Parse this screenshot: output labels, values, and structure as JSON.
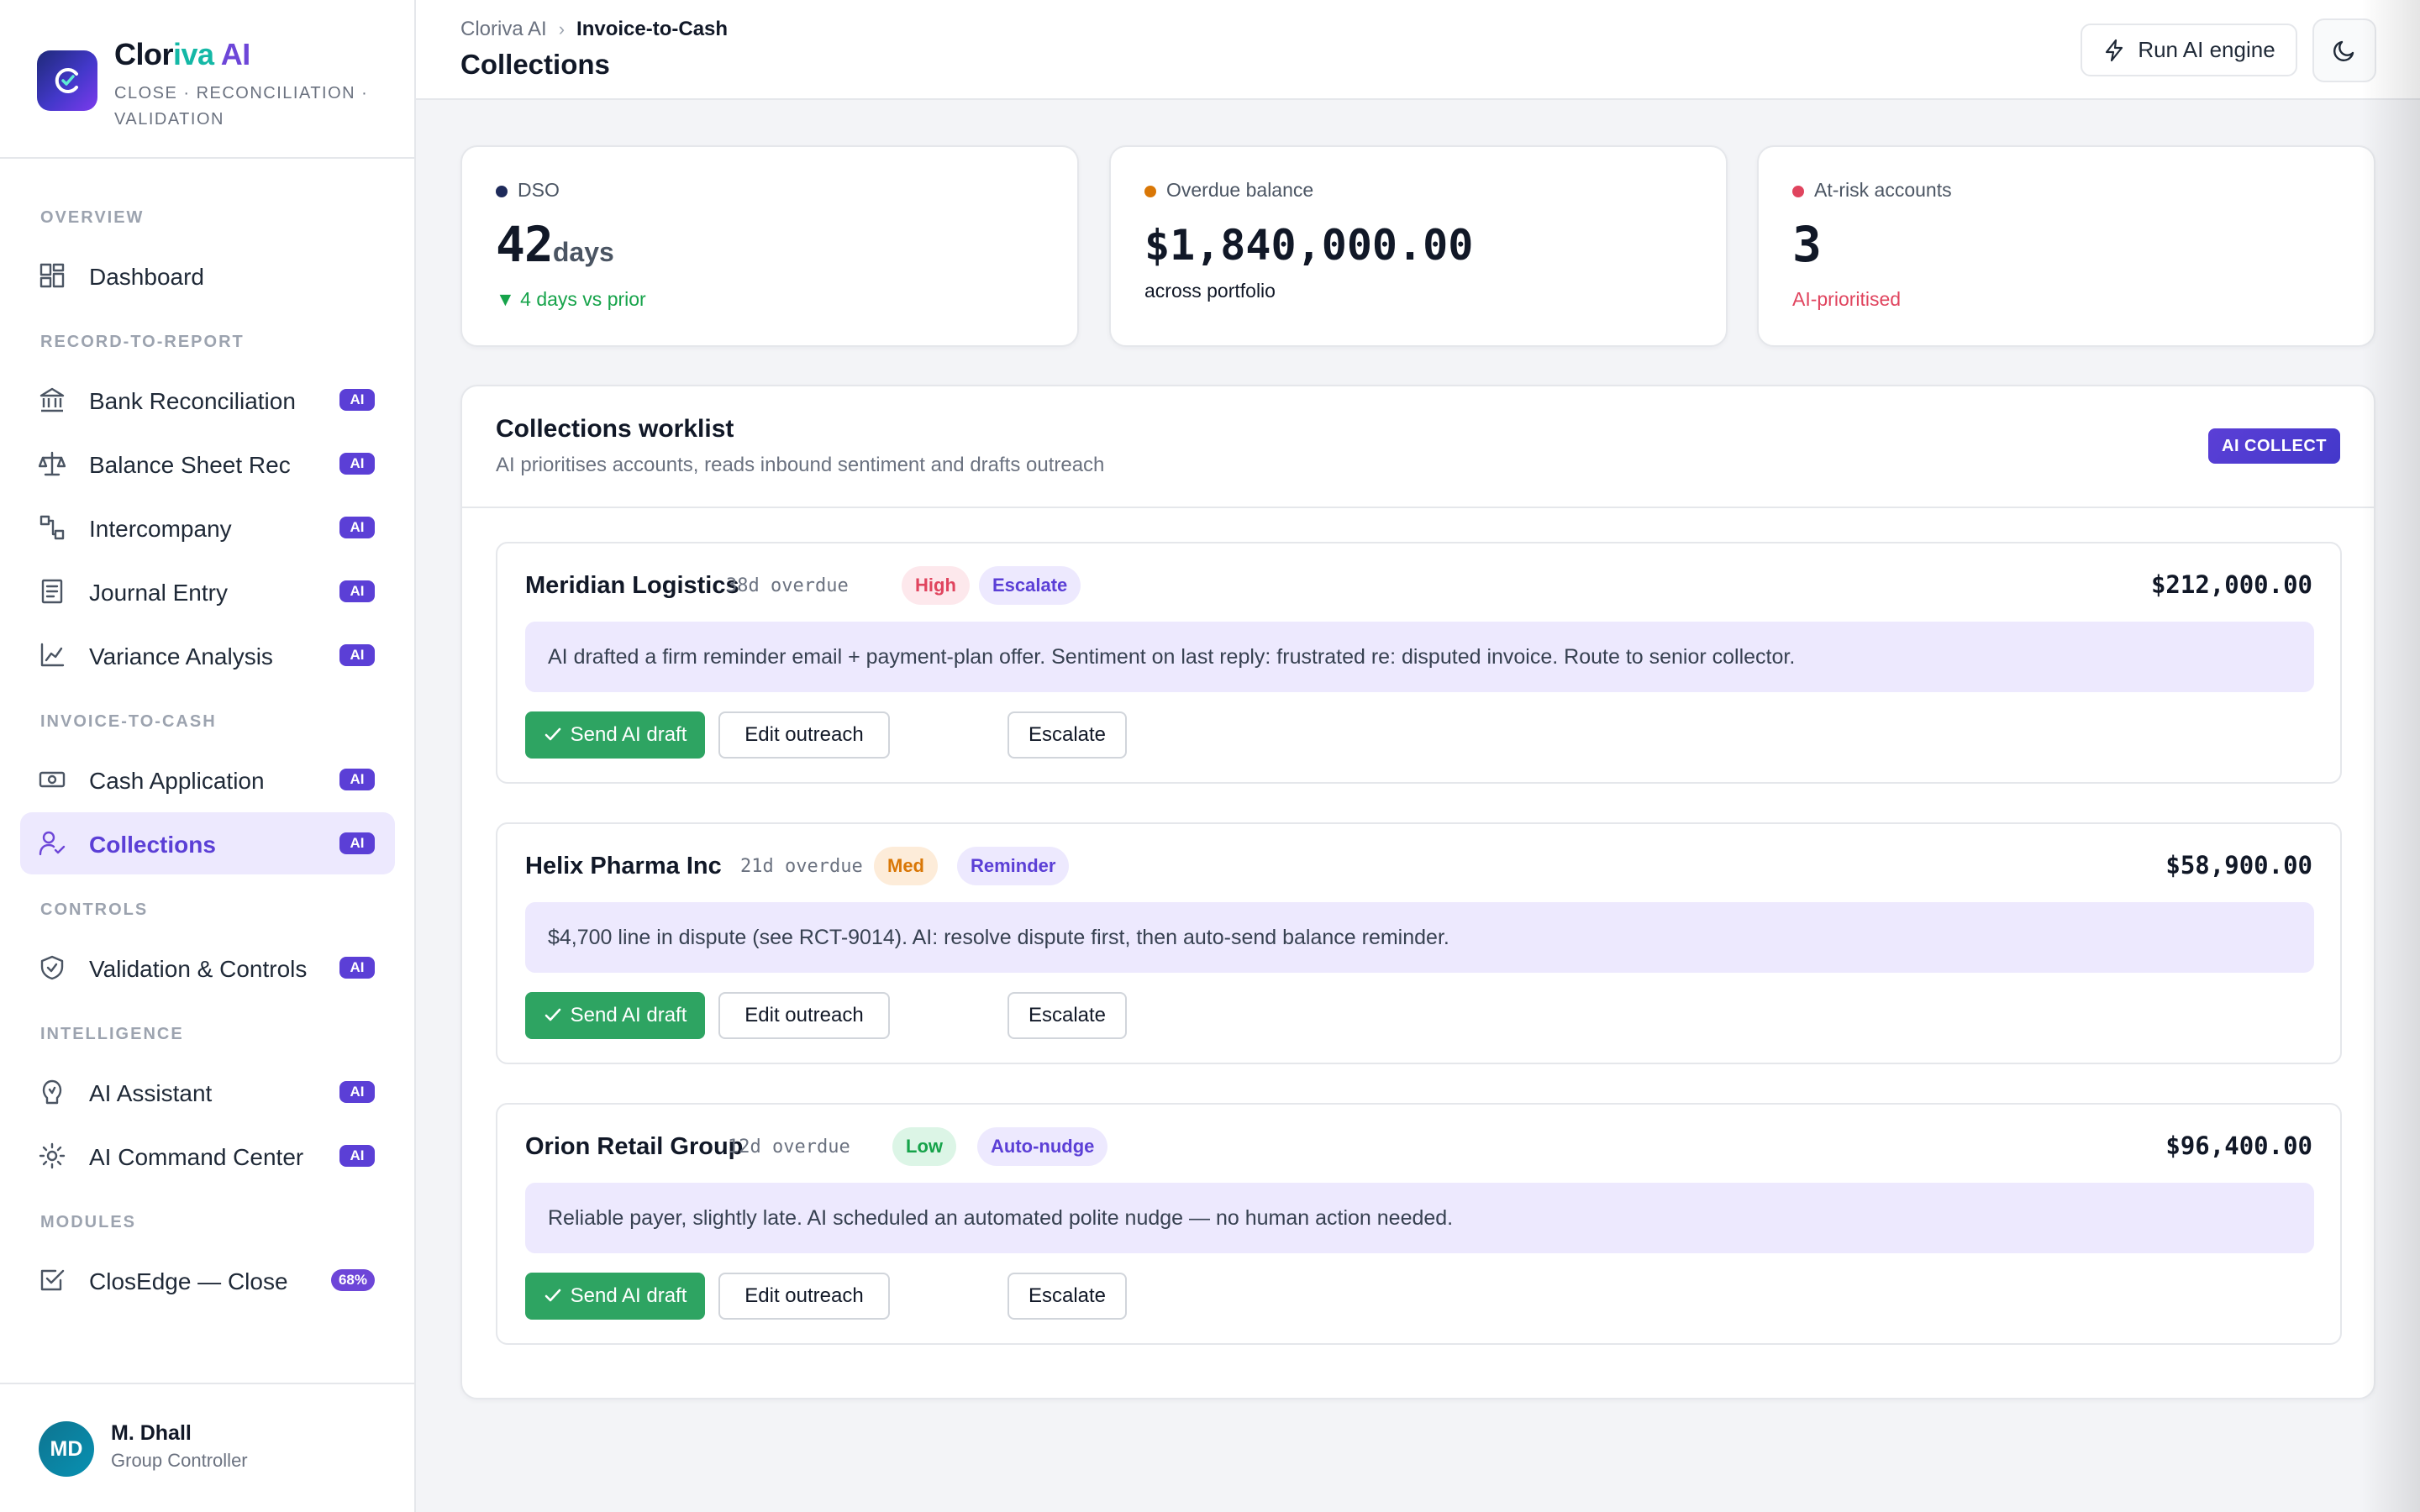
{
  "brand": {
    "name_part1": "Clor",
    "name_part2": "iva",
    "name_part3": " AI",
    "tagline": "CLOSE · RECONCILIATION · VALIDATION"
  },
  "sidebar": {
    "sections": {
      "overview": "OVERVIEW",
      "record_to_report": "RECORD-TO-REPORT",
      "invoice_to_cash": "INVOICE-TO-CASH",
      "controls": "CONTROLS",
      "intelligence": "INTELLIGENCE",
      "modules": "MODULES"
    },
    "items": [
      {
        "label": "Dashboard",
        "icon": "dashboard-icon",
        "badge": ""
      },
      {
        "label": "Bank Reconciliation",
        "icon": "bank-icon",
        "badge": "AI"
      },
      {
        "label": "Balance Sheet Rec",
        "icon": "scale-icon",
        "badge": "AI"
      },
      {
        "label": "Intercompany",
        "icon": "workflow-icon",
        "badge": "AI"
      },
      {
        "label": "Journal Entry",
        "icon": "ledger-icon",
        "badge": "AI"
      },
      {
        "label": "Variance Analysis",
        "icon": "line-chart-icon",
        "badge": "AI"
      },
      {
        "label": "Cash Application",
        "icon": "banknote-icon",
        "badge": "AI"
      },
      {
        "label": "Collections",
        "icon": "user-check-icon",
        "badge": "AI",
        "active": true
      },
      {
        "label": "Validation & Controls",
        "icon": "shield-check-icon",
        "badge": "AI"
      },
      {
        "label": "AI Assistant",
        "icon": "bot-icon",
        "badge": "AI"
      },
      {
        "label": "AI Command Center",
        "icon": "cog-icon",
        "badge": "AI"
      },
      {
        "label": "ClosEdge — Close",
        "icon": "checkbox-icon",
        "badge": "68%"
      }
    ]
  },
  "user": {
    "initials": "MD",
    "name": "M. Dhall",
    "role": "Group Controller"
  },
  "header": {
    "breadcrumb_root": "Cloriva AI",
    "breadcrumb_sep": "›",
    "breadcrumb_current": "Invoice-to-Cash",
    "title": "Collections",
    "run_button": "Run AI engine"
  },
  "kpis": [
    {
      "label": "DSO",
      "value": "42",
      "unit": "days",
      "sub": "▼ 4 days vs prior",
      "dot_color": "#1e2a5a",
      "sub_color": "#16a34a"
    },
    {
      "label": "Overdue balance",
      "value": "$1,840,000.00",
      "unit": "",
      "sub": "across portfolio",
      "dot_color": "#d97706",
      "sub_color": "#111827"
    },
    {
      "label": "At-risk accounts",
      "value": "3",
      "unit": "",
      "sub": "AI-prioritised",
      "dot_color": "#e0445e",
      "sub_color": "#e0445e"
    }
  ],
  "worklist": {
    "title": "Collections worklist",
    "subtitle": "AI prioritises accounts, reads inbound sentiment and drafts outreach",
    "badge": "AI COLLECT",
    "buttons": {
      "send": "Send AI draft",
      "edit": "Edit outreach",
      "escalate": "Escalate"
    },
    "accounts": [
      {
        "name": "Meridian Logistics",
        "overdue": "38d overdue",
        "priority": "High",
        "action": "Escalate",
        "amount": "$212,000.00",
        "note": "AI drafted a firm reminder email + payment-plan offer. Sentiment on last reply: frustrated re: disputed invoice. Route to senior collector."
      },
      {
        "name": "Helix Pharma Inc",
        "overdue": "21d overdue",
        "priority": "Med",
        "action": "Reminder",
        "amount": "$58,900.00",
        "note": "$4,700 line in dispute (see RCT-9014). AI: resolve dispute first, then auto-send balance reminder."
      },
      {
        "name": "Orion Retail Group",
        "overdue": "12d overdue",
        "priority": "Low",
        "action": "Auto-nudge",
        "amount": "$96,400.00",
        "note": "Reliable payer, slightly late. AI scheduled an automated polite nudge — no human action needed."
      }
    ]
  },
  "colors": {
    "accent": "#5b3fd6",
    "success": "#2ea462",
    "danger": "#e0445e",
    "warning": "#d97706"
  }
}
